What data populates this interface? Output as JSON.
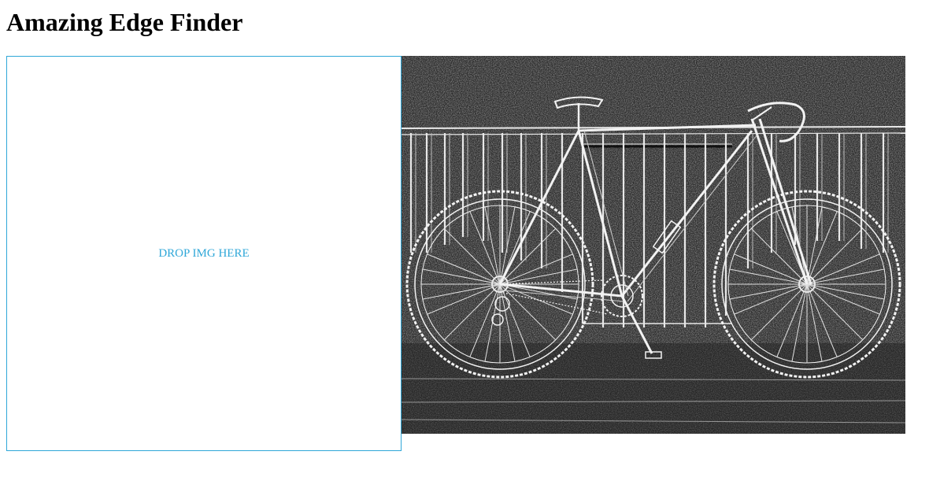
{
  "header": {
    "title": "Amazing Edge Finder"
  },
  "drop_zone": {
    "label": "DROP IMG HERE",
    "accent_color": "#2fa7d8"
  },
  "output": {
    "kind": "edge-detected photo of a bicycle leaning on a fence",
    "background_color": "#2c2c2c"
  }
}
